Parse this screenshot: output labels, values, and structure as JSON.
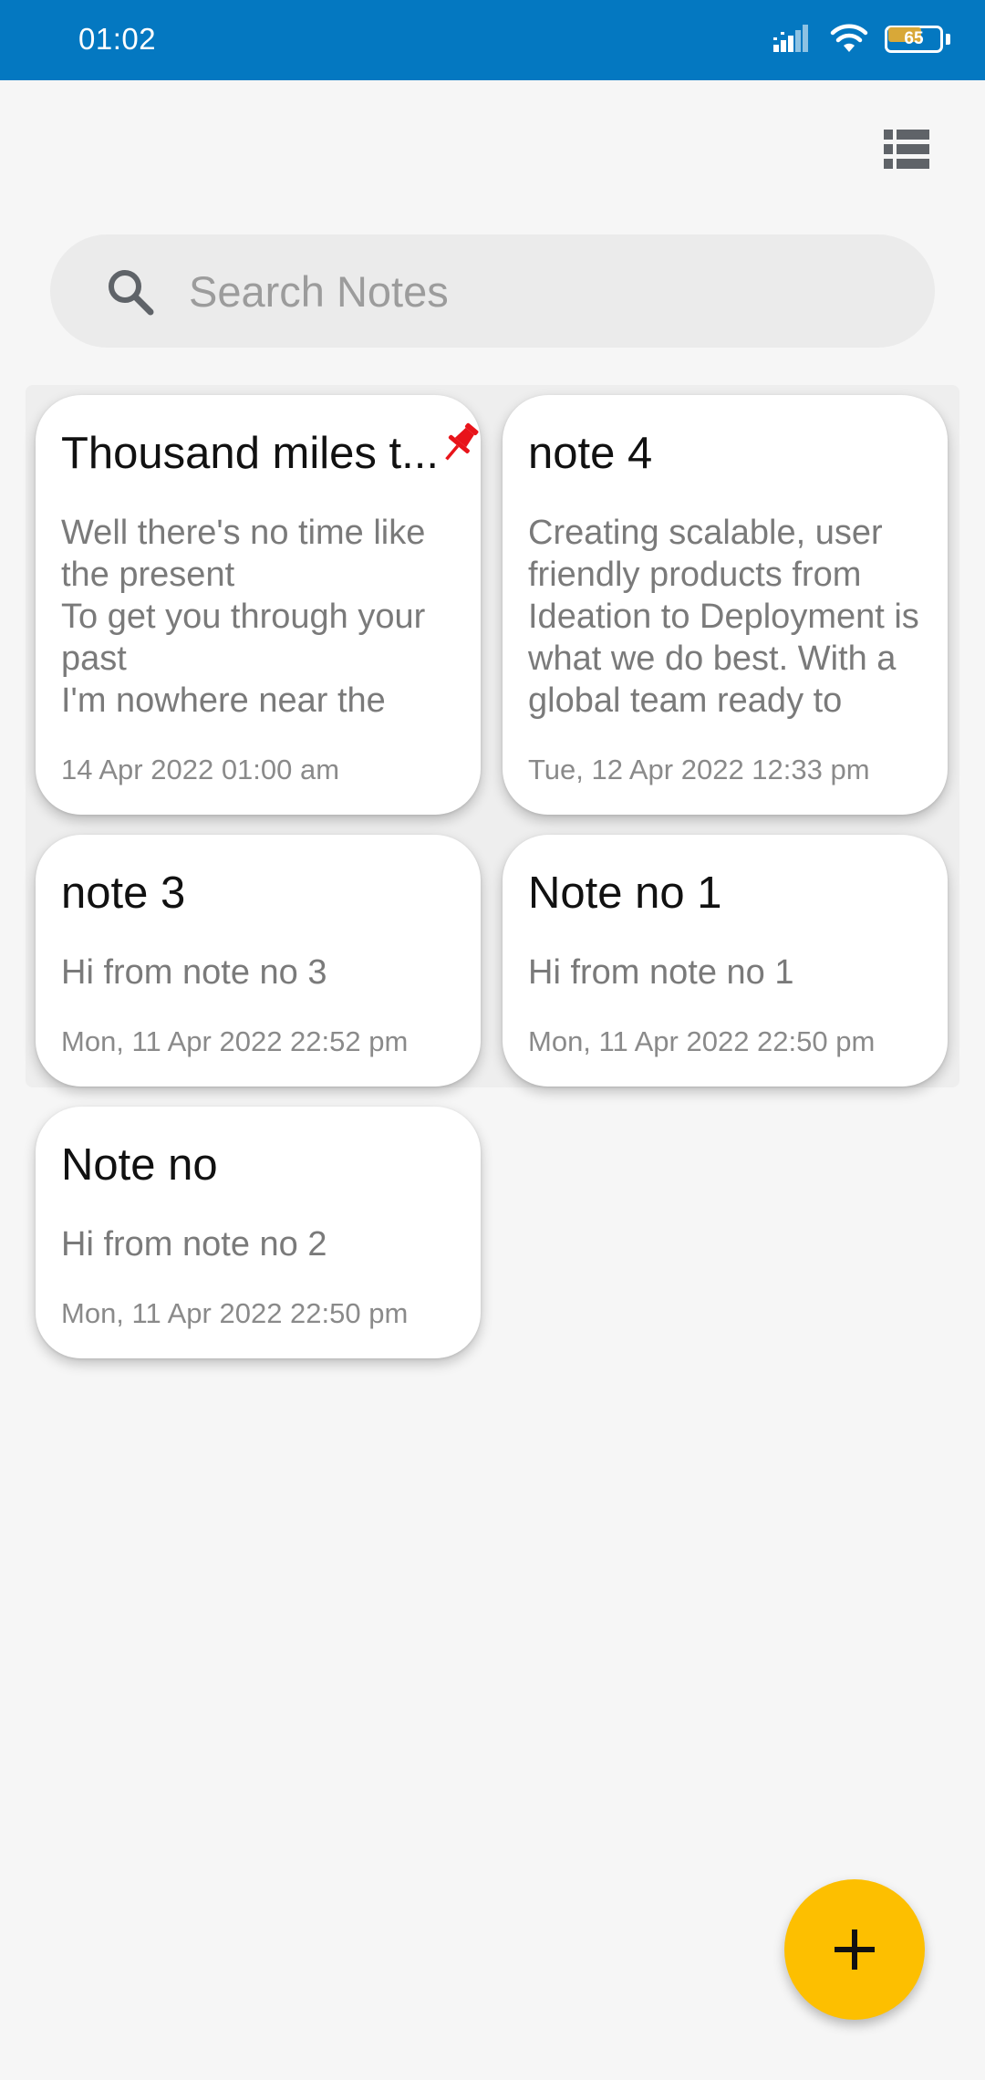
{
  "status_bar": {
    "time": "01:02",
    "battery": "65",
    "icons": [
      "signal-icon",
      "wifi-icon",
      "battery-icon"
    ]
  },
  "toolbar": {
    "view_toggle_icon": "list-view-icon"
  },
  "search": {
    "placeholder": "Search Notes",
    "value": "",
    "icon": "search-icon"
  },
  "notes": [
    {
      "title": "Thousand miles t...",
      "body": "Well there's no time like the present\nTo get you through your past\nI'm nowhere near the",
      "date": "14 Apr 2022 01:00 am",
      "pinned": true
    },
    {
      "title": "note 4",
      "body": "Creating scalable, user friendly products from Ideation to Deployment is what we do best. With a global team ready to",
      "date": "Tue, 12 Apr 2022 12:33 pm",
      "pinned": false
    },
    {
      "title": "note 3",
      "body": "Hi from note no 3",
      "date": "Mon, 11 Apr 2022 22:52 pm",
      "pinned": false
    },
    {
      "title": "Note no 1",
      "body": "Hi from note no 1",
      "date": "Mon, 11 Apr 2022 22:50 pm",
      "pinned": false
    },
    {
      "title": "Note no",
      "body": "Hi from note no 2",
      "date": "Mon, 11 Apr 2022 22:50 pm",
      "pinned": false
    }
  ],
  "fab": {
    "icon": "plus-icon"
  },
  "colors": {
    "status_bar": "#0478c1",
    "background": "#f6f6f6",
    "card": "#ffffff",
    "fab": "#fdbf00",
    "pin": "#e8141a"
  }
}
